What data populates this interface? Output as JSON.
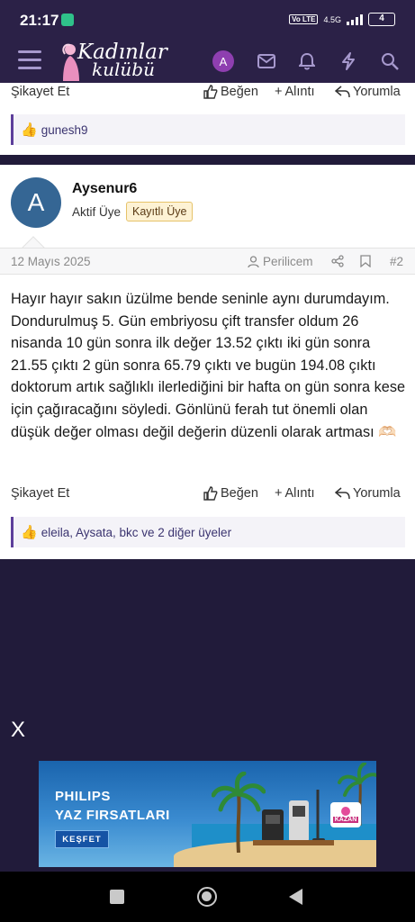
{
  "status_bar": {
    "time": "21:17",
    "network": "4.5G",
    "volte": "Vo LTE",
    "battery": "4"
  },
  "header": {
    "logo_line1": "Kadınlar",
    "logo_line2": "kulübü",
    "user_initial": "A",
    "icons": [
      "menu-icon",
      "mail-icon",
      "bell-icon",
      "bolt-icon",
      "search-icon"
    ]
  },
  "post1": {
    "report": "Şikayet Et",
    "like": "Beğen",
    "quote": "Alıntı",
    "reply": "Yorumla",
    "reactions": "gunesh9"
  },
  "post2": {
    "avatar_initial": "A",
    "username": "Aysenur6",
    "role": "Aktif Üye",
    "badge": "Kayıtlı Üye",
    "date": "12 Mayıs 2025",
    "mention": "Perilicem",
    "post_number": "#2",
    "body": "Hayır hayır sakın üzülme bende seninle aynı durumdayım. Dondurulmuş 5. Gün embriyosu çift transfer oldum 26 nisanda 10 gün sonra ilk değer 13.52 çıktı iki gün sonra 21.55 çıktı 2 gün sonra 65.79 çıktı ve bugün 194.08 çıktı doktorum artık sağlıklı ilerlediğini bir hafta on gün sonra kese için çağıracağını söyledi. Gönlünü ferah tut önemli olan düşük değer olması değil değerin düzenli olarak artması 🫶🏻",
    "report": "Şikayet Et",
    "like": "Beğen",
    "quote": "Alıntı",
    "reply": "Yorumla",
    "reactions": "eleila, Aysata, bkc ve 2 diğer üyeler"
  },
  "ad": {
    "close": "X",
    "brand": "PHILIPS",
    "headline": "YAZ FIRSATLARI",
    "cta": "KEŞFET",
    "badge": "KAZAN"
  }
}
